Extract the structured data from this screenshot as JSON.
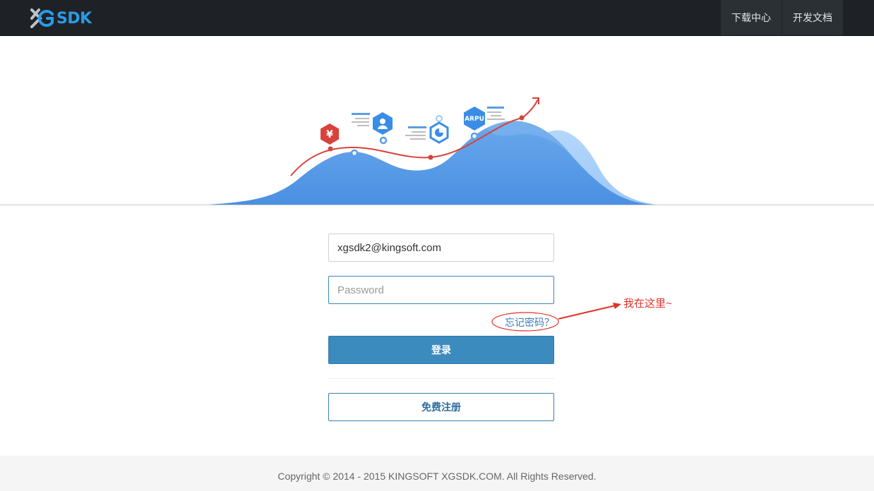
{
  "brand": {
    "logo_text": "SDK",
    "logo_mark": "XG"
  },
  "nav": {
    "items": [
      {
        "label": "下载中心"
      },
      {
        "label": "开发文档"
      }
    ]
  },
  "hero": {
    "badge_currency": "¥",
    "badge_arpu": "ARPU"
  },
  "login": {
    "email_value": "xgsdk2@kingsoft.com",
    "password_placeholder": "Password",
    "forgot_label": "忘记密码？",
    "login_label": "登录",
    "register_label": "免费注册"
  },
  "annotation": {
    "text": "我在这里~"
  },
  "footer": {
    "copyright": "Copyright © 2014 - 2015 KINGSOFT XGSDK.COM. All Rights Reserved."
  },
  "colors": {
    "navbar_bg": "#1e2226",
    "brand_blue": "#2a9be8",
    "primary_button": "#3b8bbf",
    "annotation_red": "#e0332b"
  }
}
